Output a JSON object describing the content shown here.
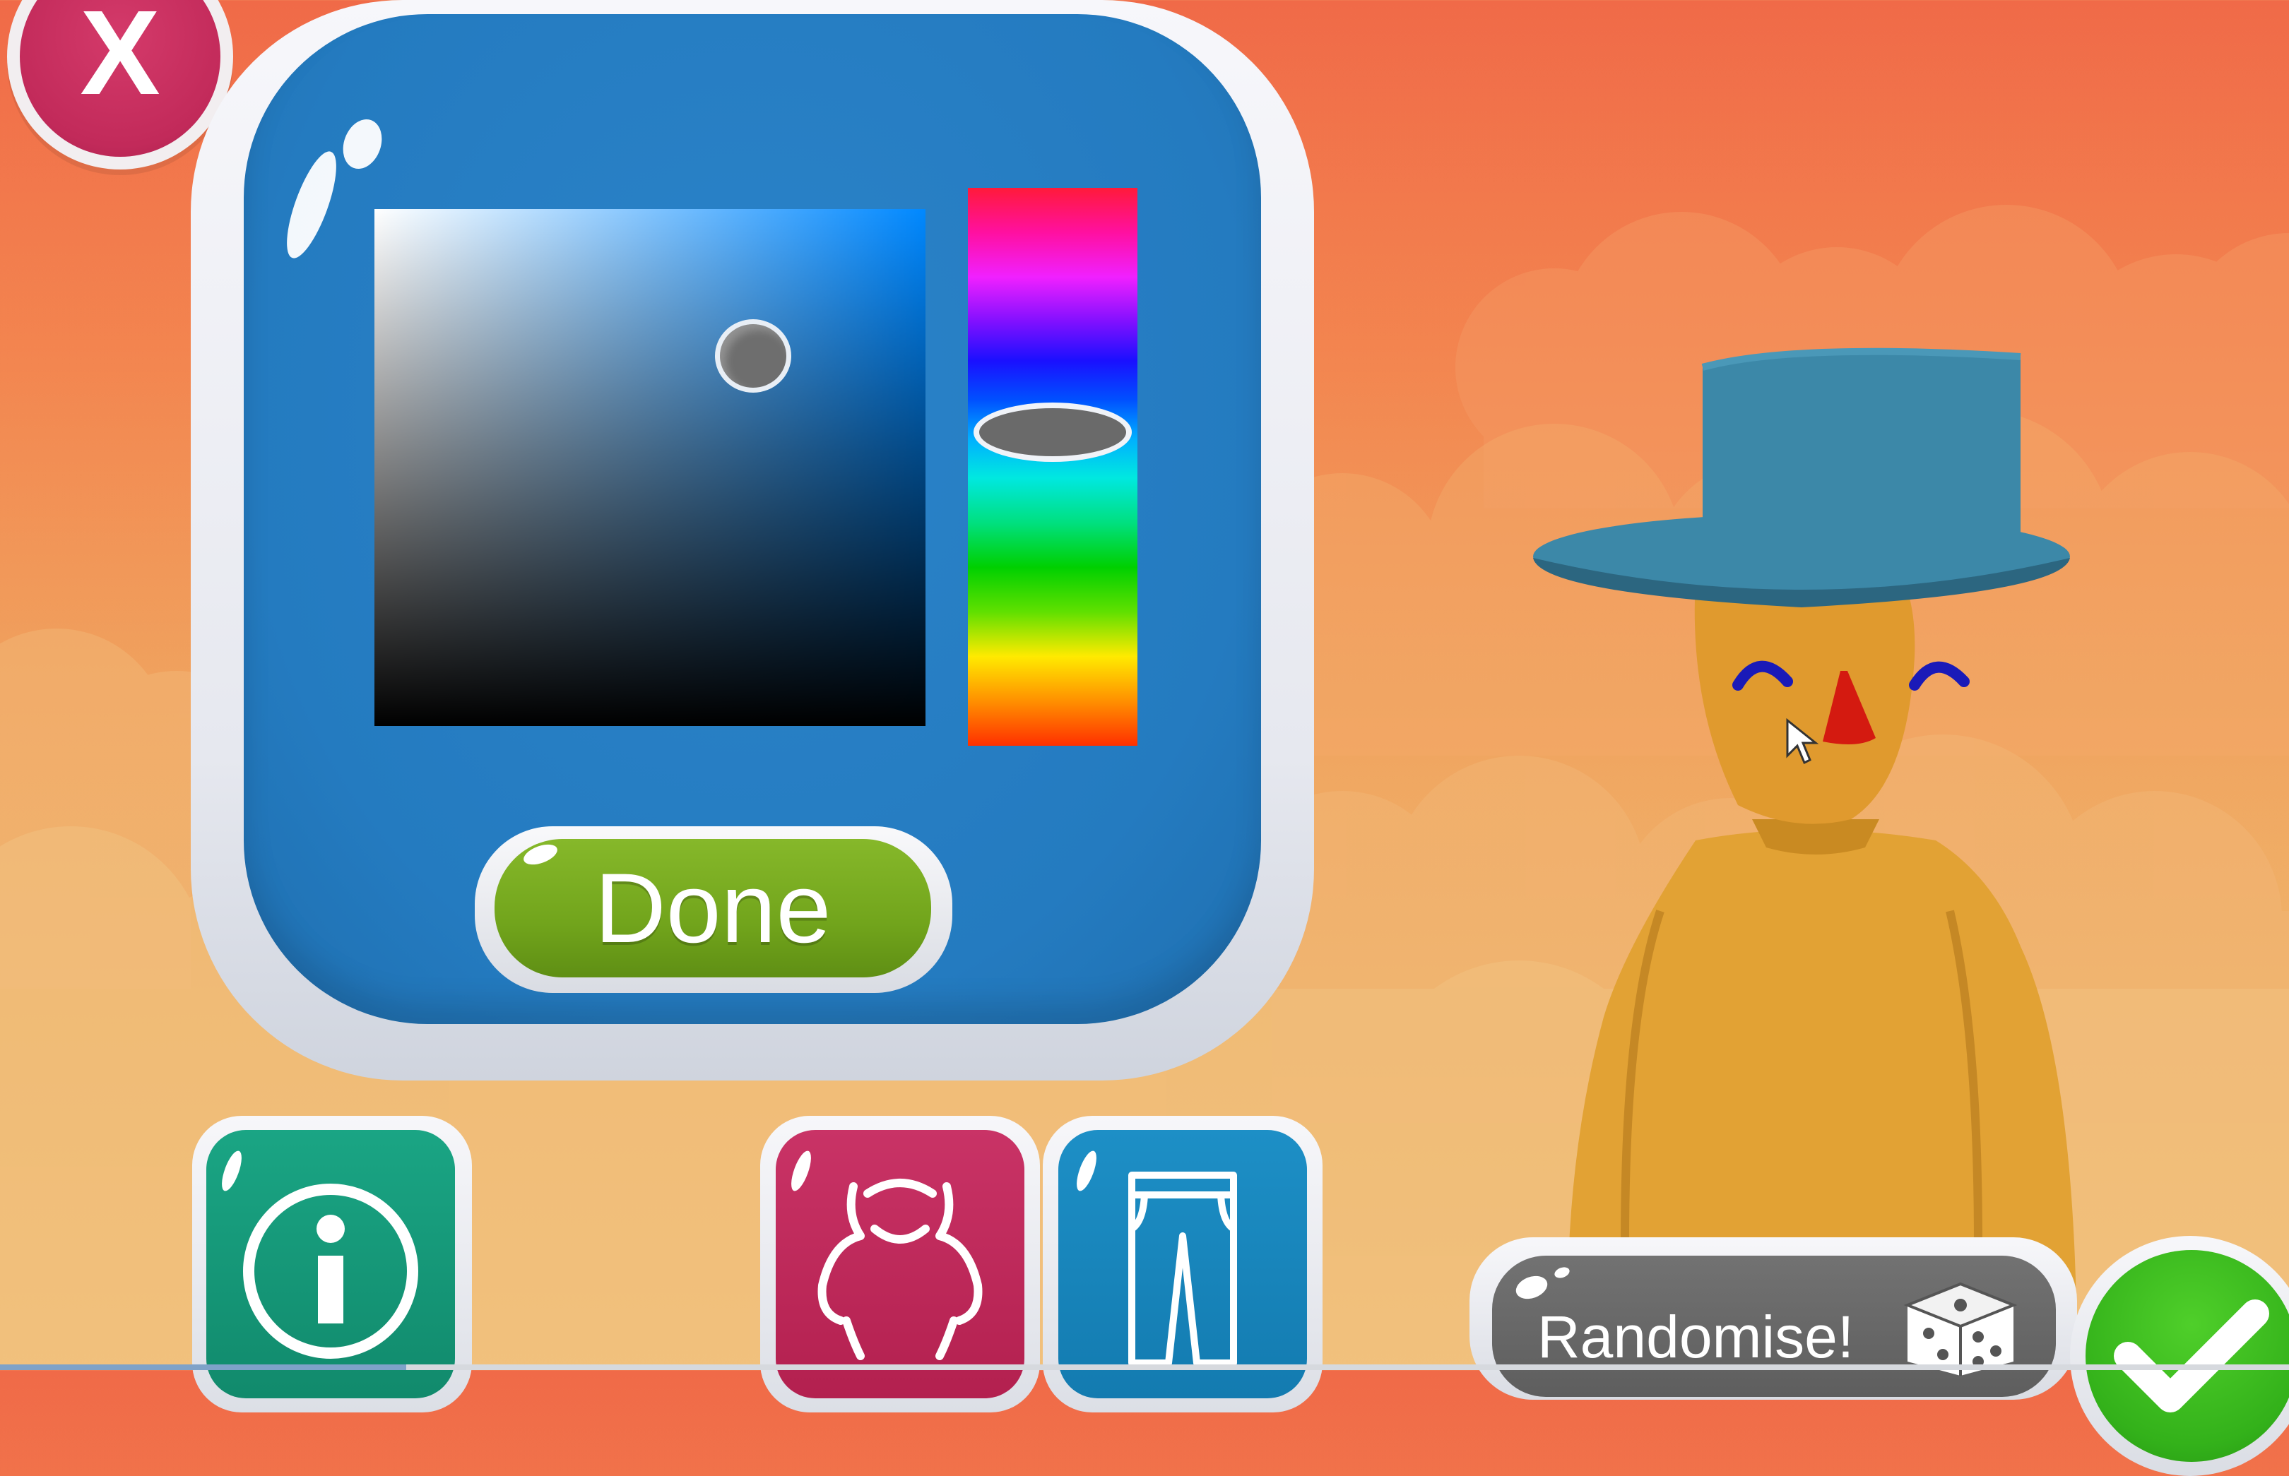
{
  "screen": "character-color-picker",
  "close_button": {
    "label": "X"
  },
  "color_picker": {
    "done_label": "Done",
    "selected_color": "#1f6fb0",
    "hue_value": "#1a10ff",
    "saturation": 0.7,
    "brightness": 0.7,
    "hue_position": 0.44
  },
  "category_buttons": [
    {
      "name": "info",
      "icon": "info-icon"
    },
    {
      "name": "body",
      "icon": "torso-icon"
    },
    {
      "name": "legs",
      "icon": "trousers-icon"
    }
  ],
  "randomise_button": {
    "label": "Randomise!",
    "icon": "dice-icon"
  },
  "confirm_button": {
    "icon": "checkmark-icon"
  },
  "character": {
    "skin_color": "#e0a235",
    "hat_color": "#3c88a8",
    "eye_color": "#1a1ab8",
    "nose_color": "#d41a10"
  },
  "colors": {
    "panel_blue": "#247bc0",
    "done_green": "#72a51c",
    "close_pink": "#c22a5a",
    "info_teal": "#1aa584",
    "body_pink": "#b3204f",
    "legs_blue": "#137bb0",
    "randomise_gray": "#666666",
    "confirm_green": "#33b11a"
  }
}
